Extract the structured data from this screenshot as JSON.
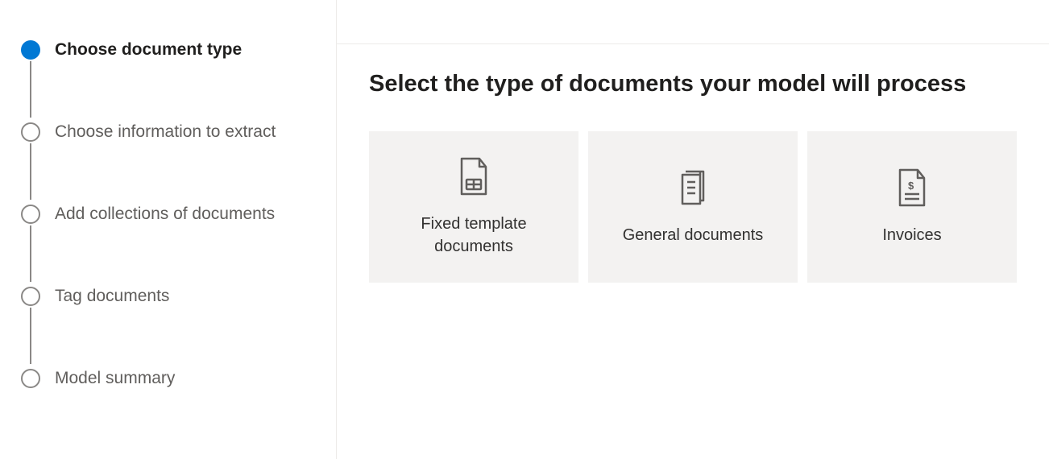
{
  "steps": [
    {
      "label": "Choose document type",
      "active": true
    },
    {
      "label": "Choose information to extract",
      "active": false
    },
    {
      "label": "Add collections of documents",
      "active": false
    },
    {
      "label": "Tag documents",
      "active": false
    },
    {
      "label": "Model summary",
      "active": false
    }
  ],
  "main": {
    "heading": "Select the type of documents your model will process",
    "cards": [
      {
        "label": "Fixed template documents"
      },
      {
        "label": "General documents"
      },
      {
        "label": "Invoices"
      }
    ]
  }
}
